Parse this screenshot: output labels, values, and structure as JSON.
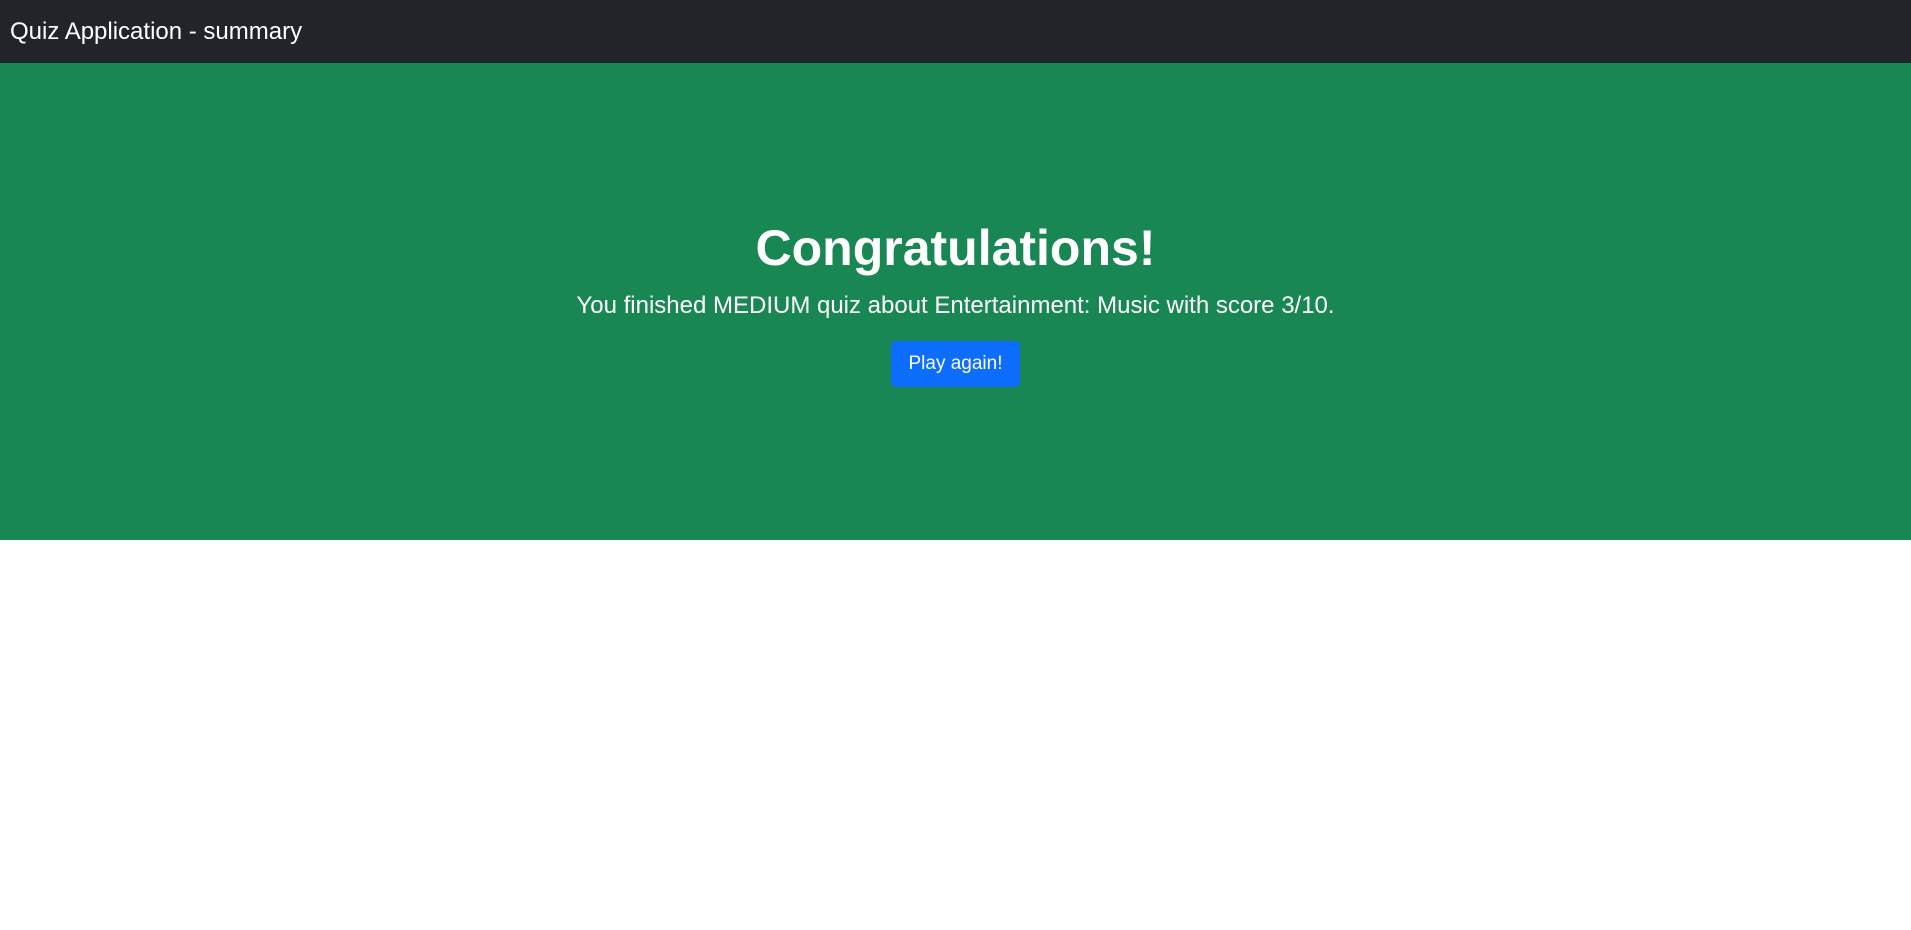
{
  "navbar": {
    "brand": "Quiz Application - summary"
  },
  "summary": {
    "title": "Congratulations!",
    "message": "You finished MEDIUM quiz about Entertainment: Music with score 3/10.",
    "play_again_label": "Play again!"
  },
  "colors": {
    "navbar_bg": "#212529",
    "hero_bg": "#198754",
    "button_bg": "#0d6efd"
  }
}
